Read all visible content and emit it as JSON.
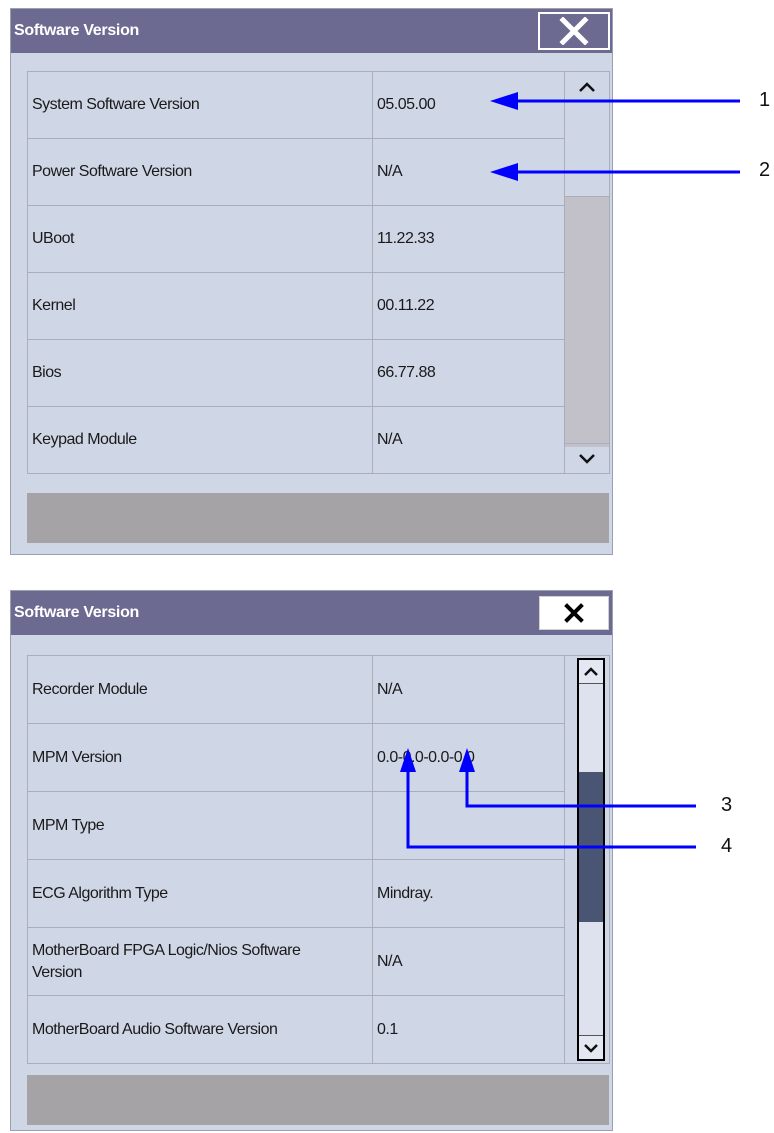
{
  "dialog1": {
    "title": "Software Version",
    "close_icon": "close-icon",
    "rows": [
      {
        "label": "System Software Version",
        "value": "05.05.00"
      },
      {
        "label": "Power Software Version",
        "value": "N/A"
      },
      {
        "label": "UBoot",
        "value": "11.22.33"
      },
      {
        "label": "Kernel",
        "value": "00.11.22"
      },
      {
        "label": "Bios",
        "value": "66.77.88"
      },
      {
        "label": "Keypad Module",
        "value": "N/A"
      }
    ]
  },
  "dialog2": {
    "title": "Software Version",
    "close_icon": "close-icon",
    "rows": [
      {
        "label": "Recorder Module",
        "value": "N/A"
      },
      {
        "label": "MPM Version",
        "value": "0.0-0.0-0.0-0.0"
      },
      {
        "label": "MPM Type",
        "value": ""
      },
      {
        "label": "ECG Algorithm Type",
        "value": "Mindray."
      },
      {
        "label": "MotherBoard FPGA Logic/Nios Software Version",
        "value": "N/A"
      },
      {
        "label": "MotherBoard Audio Software Version",
        "value": "0.1"
      }
    ]
  },
  "callouts": {
    "c1": "1",
    "c2": "2",
    "c3": "3",
    "c4": "4"
  },
  "colors": {
    "titlebar": "#6c6a90",
    "panel": "#cfd6e6",
    "footer": "#a5a3a6",
    "callout_arrow": "#0000ff",
    "thumb2": "#4a5573"
  }
}
